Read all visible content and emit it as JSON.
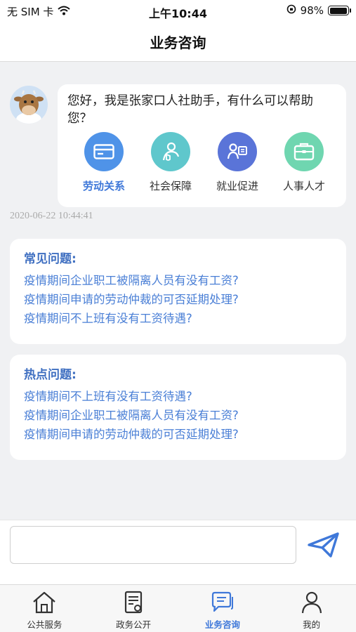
{
  "status_bar": {
    "carrier": "无 SIM 卡",
    "time": "上午10:44",
    "battery_percent": "98%",
    "battery_level": 0.98
  },
  "header": {
    "title": "业务咨询"
  },
  "chat": {
    "greeting": "您好，我是张家口人社助手，有什么可以帮助您？",
    "services": [
      {
        "label": "劳动关系",
        "icon": "card-icon",
        "color": "#4f93e8",
        "active": true
      },
      {
        "label": "社会保障",
        "icon": "person-shield-icon",
        "color": "#5fc7cc",
        "active": false
      },
      {
        "label": "就业促进",
        "icon": "employment-icon",
        "color": "#5a74d8",
        "active": false
      },
      {
        "label": "人事人才",
        "icon": "briefcase-icon",
        "color": "#6fd6b0",
        "active": false
      }
    ],
    "timestamp": "2020-06-22 10:44:41"
  },
  "faq": {
    "title": "常见问题:",
    "items": [
      "疫情期间企业职工被隔离人员有没有工资?",
      "疫情期间申请的劳动仲裁的可否延期处理?",
      "疫情期间不上班有没有工资待遇?"
    ]
  },
  "hot": {
    "title": "热点问题:",
    "items": [
      "疫情期间不上班有没有工资待遇?",
      "疫情期间企业职工被隔离人员有没有工资?",
      "疫情期间申请的劳动仲裁的可否延期处理?"
    ]
  },
  "input": {
    "value": "",
    "placeholder": ""
  },
  "tabs": [
    {
      "label": "公共服务",
      "icon": "home-icon",
      "active": false
    },
    {
      "label": "政务公开",
      "icon": "document-icon",
      "active": false
    },
    {
      "label": "业务咨询",
      "icon": "chat-icon",
      "active": true
    },
    {
      "label": "我的",
      "icon": "user-icon",
      "active": false
    }
  ],
  "colors": {
    "accent": "#3f78d9",
    "link": "#4a7fd6",
    "background": "#f0f1f3"
  }
}
